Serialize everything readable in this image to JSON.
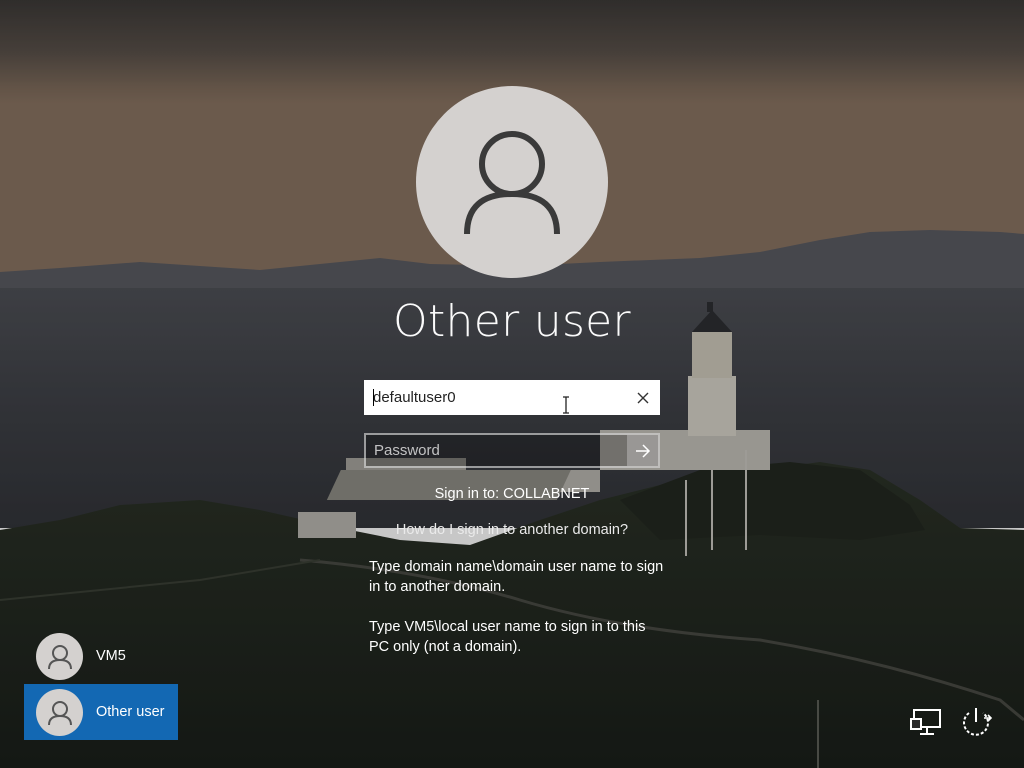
{
  "user": {
    "name": "Other user",
    "username_value": "defaultuser0",
    "password_placeholder": "Password"
  },
  "signin": {
    "domain_text": "Sign in to: COLLABNET",
    "help_link": "How do I sign in to another domain?",
    "help_line1": "Type domain name\\domain user name to sign in to another domain.",
    "help_line2": "Type VM5\\local user name to sign in to this PC only (not a domain)."
  },
  "user_list": [
    {
      "name": "VM5",
      "selected": false
    },
    {
      "name": "Other user",
      "selected": true
    }
  ],
  "icons": {
    "clear": "close-icon",
    "submit": "arrow-right-icon",
    "network": "network-icon",
    "power": "power-icon"
  },
  "colors": {
    "selected_tile": "#1368b3",
    "avatar_bg": "#d4d1cf"
  }
}
